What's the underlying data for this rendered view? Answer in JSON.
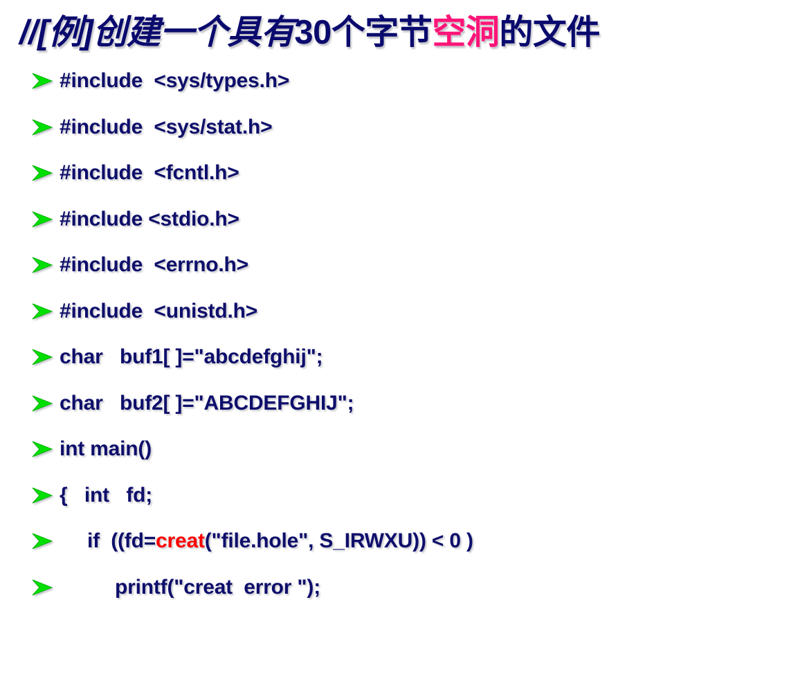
{
  "slide": {
    "title": {
      "prefix": "//[例]创建一个具有",
      "number": "30",
      "middle": "个字节",
      "highlight": "空洞",
      "suffix": "的文件",
      "full_text": "//[例]创建一个具有30个字节空洞的文件",
      "color": "#0a0a6e",
      "highlight_color": "#ff1478"
    },
    "bullet_icon": "green-arrow-bullet-icon",
    "bullet_color": "#00e000",
    "code_color": "#0e0e6b",
    "accent_color": "#fc0000",
    "lines": [
      {
        "text": "#include  <sys/types.h>",
        "indent": 0
      },
      {
        "text": "#include  <sys/stat.h>",
        "indent": 0
      },
      {
        "text": "#include  <fcntl.h>",
        "indent": 0
      },
      {
        "text": "#include <stdio.h>",
        "indent": 0
      },
      {
        "text": "#include  <errno.h>",
        "indent": 0
      },
      {
        "text": "#include  <unistd.h>",
        "indent": 0
      },
      {
        "text": "char   buf1[ ]=\"abcdefghij\";",
        "indent": 0
      },
      {
        "text": "char   buf2[ ]=\"ABCDEFGHIJ\";",
        "indent": 0
      },
      {
        "text": "int main()",
        "indent": 0
      },
      {
        "text": "{   int   fd;",
        "indent": 0
      },
      {
        "text": "if  ((fd=creat(\"file.hole\", S_IRWXU)) < 0 )",
        "indent": 1,
        "accent": "creat",
        "pre": "if  ((fd=",
        "post": "(\"file.hole\", S_IRWXU)) < 0 )"
      },
      {
        "text": "printf(\"creat  error \");",
        "indent": 2
      }
    ]
  }
}
